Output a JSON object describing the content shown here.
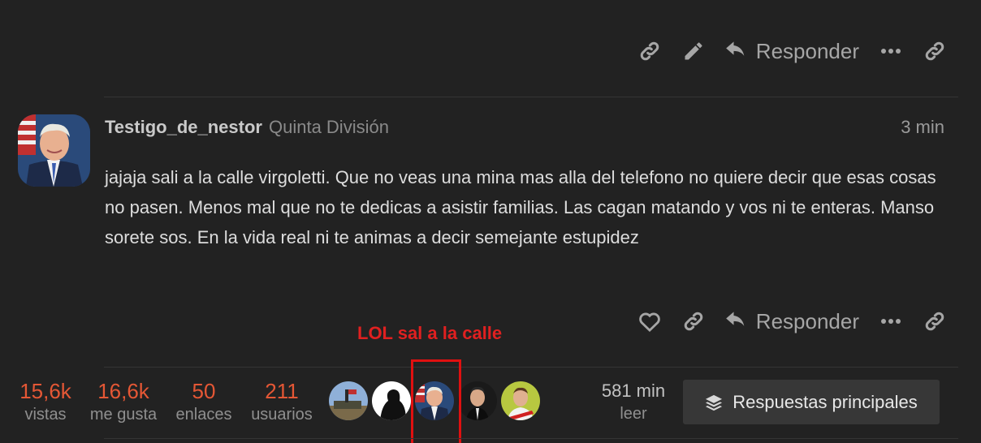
{
  "previous_post_actions": {
    "reply_label": "Responder"
  },
  "post": {
    "username": "Testigo_de_nestor",
    "user_title": "Quinta División",
    "date": "3 min",
    "body": "jajaja sali a la calle virgoletti. Que no veas una mina mas alla del telefono no quiere decir que esas cosas no pasen. Menos mal que no te dedicas a asistir familias. Las cagan matando y vos ni te enteras. Manso sorete sos. En la vida real ni te animas a decir semejante estupidez",
    "reply_label": "Responder"
  },
  "annotation": {
    "text": "LOL sal a la calle",
    "color": "#e02020"
  },
  "topic_map": {
    "views": {
      "value": "15,6k",
      "label": "vistas"
    },
    "likes": {
      "value": "16,6k",
      "label": "me gusta"
    },
    "links": {
      "value": "50",
      "label": "enlaces"
    },
    "users": {
      "value": "211",
      "label": "usuarios"
    },
    "read_time": {
      "value": "581 min",
      "label": "leer"
    },
    "top_replies_label": "Respuestas principales"
  },
  "colors": {
    "accent": "#e45735",
    "background": "#222222",
    "muted": "#a6a6a6"
  },
  "icons": [
    "link-icon",
    "pencil-icon",
    "reply-icon",
    "ellipsis-icon",
    "heart-icon",
    "layers-icon"
  ]
}
